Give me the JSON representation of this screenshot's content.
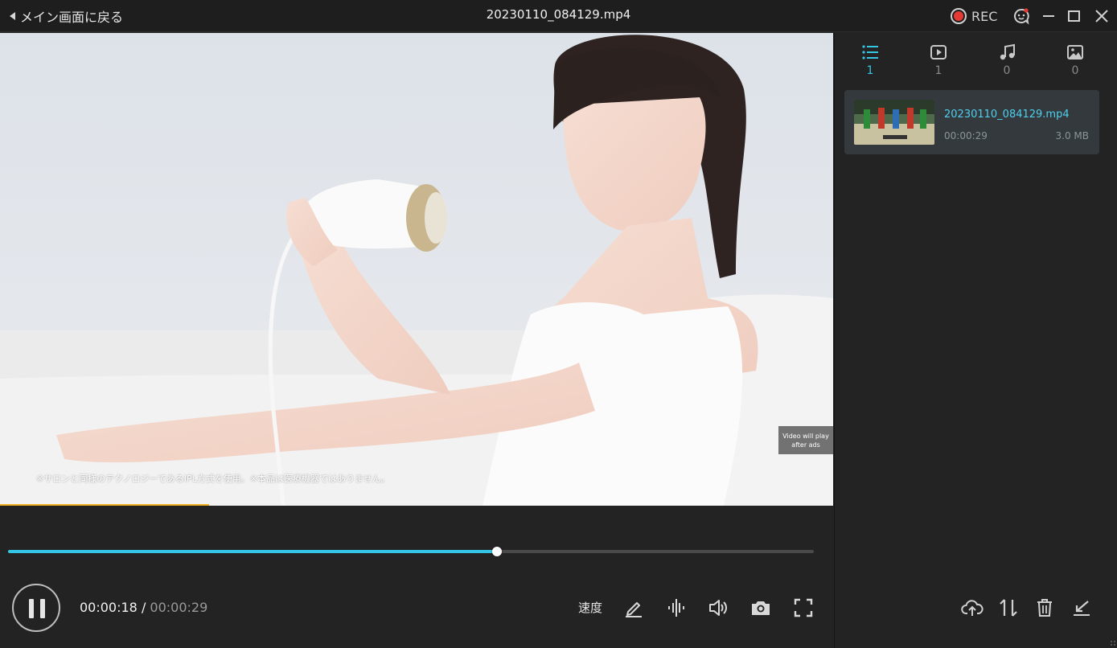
{
  "titlebar": {
    "back_label": "メイン画面に戻る",
    "file_title": "20230110_084129.mp4",
    "rec_label": "REC",
    "icons": [
      "back-arrow-icon",
      "record-icon",
      "feedback-icon",
      "minimize-icon",
      "maximize-icon",
      "close-icon"
    ]
  },
  "video": {
    "caption": "※サロンと同様のテクノロジーであるIPL方式を使用。※本品は医療機器ではありません。",
    "ad_notice_line1": "Video will play",
    "ad_notice_line2": "after ads"
  },
  "player": {
    "current_time": "00:00:18",
    "separator": " / ",
    "total_time": "00:00:29",
    "progress_fraction": 0.607,
    "speed_label": "速度",
    "controls": [
      "pause-icon",
      "edit-icon",
      "audio-track-icon",
      "volume-icon",
      "screenshot-icon",
      "fullscreen-icon"
    ]
  },
  "sidebar": {
    "tabs": [
      {
        "icon": "list-icon",
        "count": "1",
        "active": true
      },
      {
        "icon": "video-icon",
        "count": "1",
        "active": false
      },
      {
        "icon": "music-icon",
        "count": "0",
        "active": false
      },
      {
        "icon": "image-icon",
        "count": "0",
        "active": false
      }
    ],
    "file": {
      "name": "20230110_084129.mp4",
      "duration": "00:00:29",
      "size": "3.0 MB"
    },
    "actions": [
      "cloud-upload-icon",
      "sort-icon",
      "trash-icon",
      "import-icon"
    ]
  },
  "colors": {
    "accent": "#35c6e6",
    "background": "#232323",
    "titlebar": "#1e1e1e",
    "card": "#33393d",
    "record": "#e53935"
  }
}
